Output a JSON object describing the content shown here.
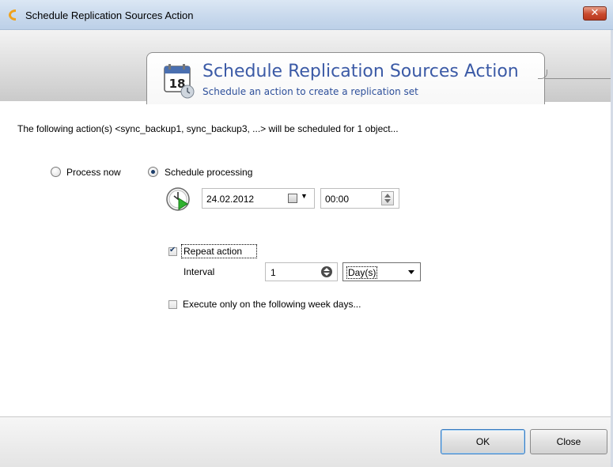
{
  "window": {
    "title": "Schedule Replication Sources Action",
    "close_label": "✕"
  },
  "header": {
    "title": "Schedule Replication Sources Action",
    "subtitle": "Schedule an action to create a replication set",
    "calendar_day": "18"
  },
  "info_text": "The following action(s) <sync_backup1, sync_backup3, ...> will be scheduled for 1 object...",
  "processing": {
    "process_now_label": "Process now",
    "process_now_checked": false,
    "schedule_label": "Schedule processing",
    "schedule_checked": true,
    "date": "24.02.2012",
    "time": "00:00"
  },
  "repeat": {
    "label": "Repeat action",
    "checked": true,
    "interval_label": "Interval",
    "interval_value": "1",
    "unit": "Day(s)"
  },
  "weekdays": {
    "label": "Execute only on the following week days...",
    "checked": false
  },
  "footer": {
    "ok_label": "OK",
    "close_label": "Close"
  },
  "colors": {
    "header_title": "#3b5aa6",
    "titlebar": "#c7d8ec"
  }
}
